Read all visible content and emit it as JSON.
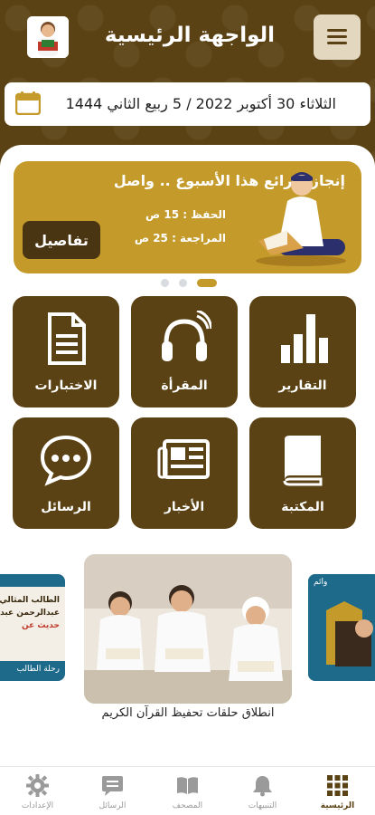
{
  "header": {
    "title": "الواجهة الرئيسية",
    "menu_icon": "hamburger-menu-icon",
    "avatar_icon": "student-avatar"
  },
  "date_bar": {
    "text": "الثلاثاء 30 أكتوبر 2022 / 5 ربيع الثاني 1444",
    "icon": "calendar-icon"
  },
  "banner": {
    "title": "إنجازك رائع هذا الأسبوع .. واصل",
    "memorize": "الحفظ : 15 ص",
    "review": "المراجعة : 25 ص",
    "details_label": "تفاصيل",
    "slide_count": 3,
    "active_slide": 2
  },
  "tiles": [
    {
      "label": "التقارير",
      "icon": "bar-chart-icon"
    },
    {
      "label": "المقرأة",
      "icon": "headphones-icon"
    },
    {
      "label": "الاختبارات",
      "icon": "document-icon"
    },
    {
      "label": "المكتبة",
      "icon": "book-icon"
    },
    {
      "label": "الأخبار",
      "icon": "newspaper-icon"
    },
    {
      "label": "الرسائل",
      "icon": "chat-bubble-icon"
    }
  ],
  "news": {
    "caption": "انطلاق حلقات تحفيظ القرآن الكريم",
    "left_card_lines": [
      "الطالب المثالي",
      "عبدالرحمن عبدا",
      "حديث عن",
      "رحلة الطالب"
    ],
    "right_card_text": "وائم"
  },
  "bottom_nav": [
    {
      "label": "الرئيسية",
      "icon": "grid-icon",
      "active": true
    },
    {
      "label": "التنبيهات",
      "icon": "bell-icon",
      "active": false
    },
    {
      "label": "المصحف",
      "icon": "open-book-icon",
      "active": false
    },
    {
      "label": "الرسائل",
      "icon": "message-icon",
      "active": false
    },
    {
      "label": "الإعدادات",
      "icon": "gear-icon",
      "active": false
    }
  ],
  "colors": {
    "primary_brown": "#5b4214",
    "gold": "#c49a2b",
    "menu_bg": "#e3d7bf"
  }
}
